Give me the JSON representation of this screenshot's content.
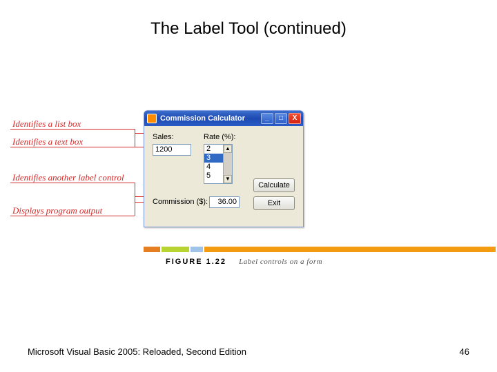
{
  "title": "The Label Tool (continued)",
  "callouts": {
    "c1": "Identifies a list box",
    "c2": "Identifies a text box",
    "c3": "Identifies another label control",
    "c4": "Displays program output"
  },
  "form": {
    "title": "Commission Calculator",
    "salesLabel": "Sales:",
    "rateLabel": "Rate (%):",
    "salesValue": "1200",
    "commissionLabel": "Commission ($):",
    "commissionValue": "36.00",
    "calculateBtn": "Calculate",
    "exitBtn": "Exit",
    "listItems": [
      "2",
      "3",
      "4",
      "5"
    ],
    "listSelectedIndex": 1,
    "winBtns": {
      "min": "_",
      "max": "□",
      "close": "X"
    }
  },
  "figure": {
    "number": "FIGURE 1.22",
    "caption": "Label controls on a form"
  },
  "footer": {
    "left": "Microsoft Visual Basic 2005: Reloaded, Second Edition",
    "right": "46"
  }
}
